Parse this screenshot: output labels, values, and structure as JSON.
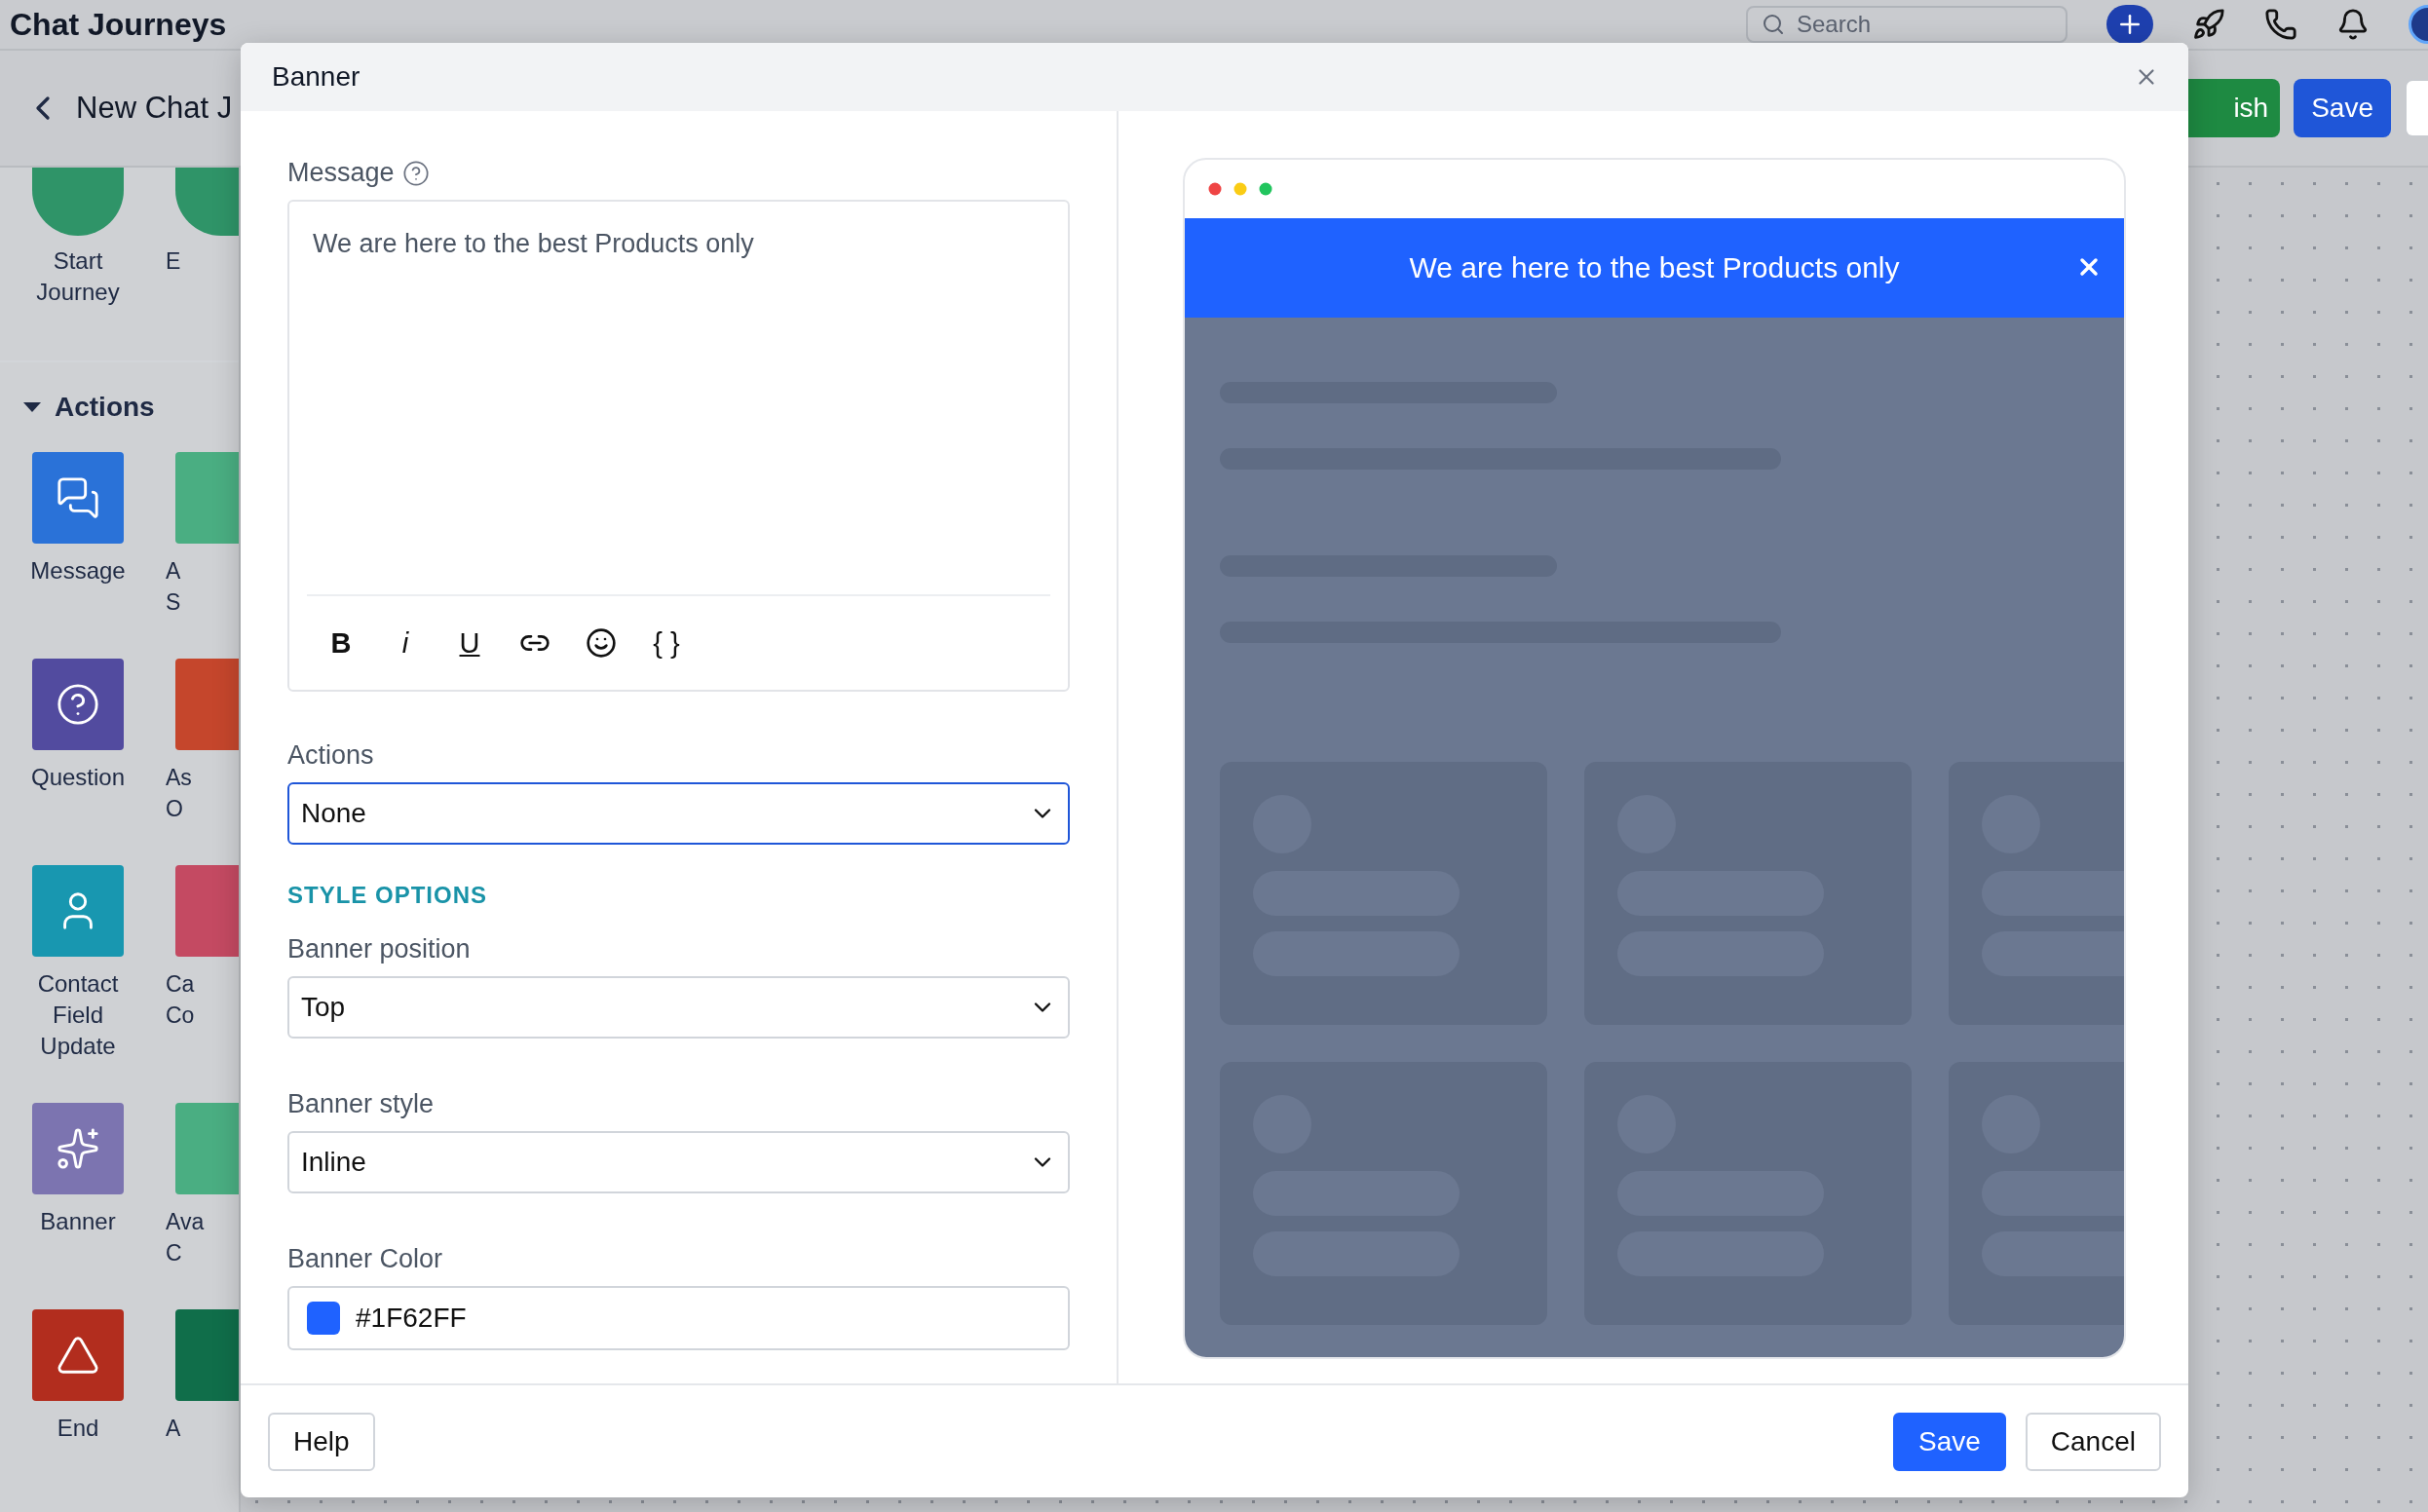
{
  "app_header": {
    "title": "Chat Journeys",
    "search": {
      "placeholder": "Search"
    }
  },
  "journey_bar": {
    "title": "New Chat J",
    "buttons": [
      {
        "label": "ish",
        "kind": "publish"
      },
      {
        "label": "Save",
        "kind": "primary"
      }
    ]
  },
  "sidebar": {
    "start_items": [
      {
        "lines": [
          "Start",
          "Journey"
        ],
        "color": "#2f9468"
      },
      {
        "lines": [
          "E"
        ],
        "color": "#2f9468"
      }
    ],
    "section": {
      "title": "Actions",
      "expanded": true
    },
    "rows": [
      {
        "main": {
          "kind": "message",
          "lines": [
            "Message"
          ],
          "color": "#2a72d8"
        },
        "side": {
          "lines": [
            "A",
            "S"
          ],
          "color": "#4aae82"
        }
      },
      {
        "main": {
          "kind": "question",
          "lines": [
            "Question"
          ],
          "color": "#524b9f"
        },
        "side": {
          "lines": [
            "As",
            "O"
          ],
          "color": "#c5462c"
        }
      },
      {
        "main": {
          "kind": "contact",
          "lines": [
            "Contact",
            "Field",
            "Update"
          ],
          "color": "#1897b0"
        },
        "side": {
          "lines": [
            "Ca",
            "Co"
          ],
          "color": "#c44a62"
        }
      },
      {
        "main": {
          "kind": "banner",
          "lines": [
            "Banner"
          ],
          "color": "#7c74b0"
        },
        "side": {
          "lines": [
            "Ava",
            "C"
          ],
          "color": "#4aae82"
        }
      },
      {
        "main": {
          "kind": "end",
          "lines": [
            "End"
          ],
          "color": "#b22d1e"
        },
        "side": {
          "lines": [
            "A"
          ],
          "color": "#106e4a"
        }
      }
    ]
  },
  "modal": {
    "title": "Banner",
    "message": {
      "label": "Message",
      "value": "We are here to the best Products only",
      "toolbar": [
        {
          "kind": "bold",
          "label": "B"
        },
        {
          "kind": "italic",
          "label": "i"
        },
        {
          "kind": "underline",
          "label": "U"
        },
        {
          "kind": "link"
        },
        {
          "kind": "emoji"
        },
        {
          "kind": "variable",
          "label": "{ }"
        }
      ]
    },
    "actions": {
      "label": "Actions",
      "value": "None",
      "focused": true
    },
    "style_heading": "STYLE OPTIONS",
    "style_fields": [
      {
        "label": "Banner position",
        "value": "Top",
        "focused": false
      },
      {
        "label": "Banner style",
        "value": "Inline",
        "focused": false
      }
    ],
    "color_field": {
      "label": "Banner Color",
      "value": "#1F62FF"
    },
    "preview": {
      "message": "We are here to the best Products only"
    },
    "footer": {
      "help": "Help",
      "save": "Save",
      "cancel": "Cancel"
    }
  }
}
